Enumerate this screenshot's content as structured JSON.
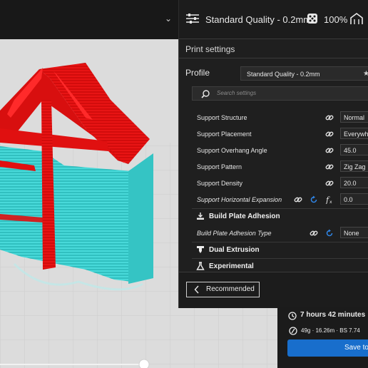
{
  "topbar": {
    "quality_label": "Standard Quality - 0.2mm",
    "infill_label": "100%",
    "chevron": "⌄"
  },
  "panel": {
    "title": "Print settings",
    "profile_label": "Profile",
    "profile_value": "Standard Quality - 0.2mm",
    "profile_star": "★",
    "search_placeholder": "Search settings",
    "settings": [
      {
        "label": "Support Structure",
        "value": "Normal"
      },
      {
        "label": "Support Placement",
        "value": "Everywhere"
      },
      {
        "label": "Support Overhang Angle",
        "value": "45.0"
      },
      {
        "label": "Support Pattern",
        "value": "Zig Zag"
      },
      {
        "label": "Support Density",
        "value": "20.0"
      },
      {
        "label": "Support Horizontal Expansion",
        "value": "0.0"
      }
    ],
    "sections": {
      "build_plate": "Build Plate Adhesion",
      "dual_extrusion": "Dual Extrusion",
      "experimental": "Experimental"
    },
    "adhesion_type": {
      "label": "Build Plate Adhesion Type",
      "value": "None"
    },
    "recommended_button": "Recommended"
  },
  "estimate": {
    "time": "7 hours 42 minutes",
    "material": "49g · 16.26m · BS 7.74",
    "save_button": "Save to"
  },
  "colors": {
    "model_red": "#e01010",
    "support_cyan": "#3bd6d6",
    "accent_blue": "#186ecc",
    "panel_bg": "#1f1f1f"
  },
  "icons": [
    "settings-sliders-icon",
    "infill-dice-icon",
    "support-icon",
    "search-icon",
    "link-icon",
    "reset-icon",
    "function-icon",
    "build-plate-icon",
    "dual-extrusion-icon",
    "flask-icon",
    "chevron-left-icon",
    "clock-icon",
    "speed-icon"
  ]
}
